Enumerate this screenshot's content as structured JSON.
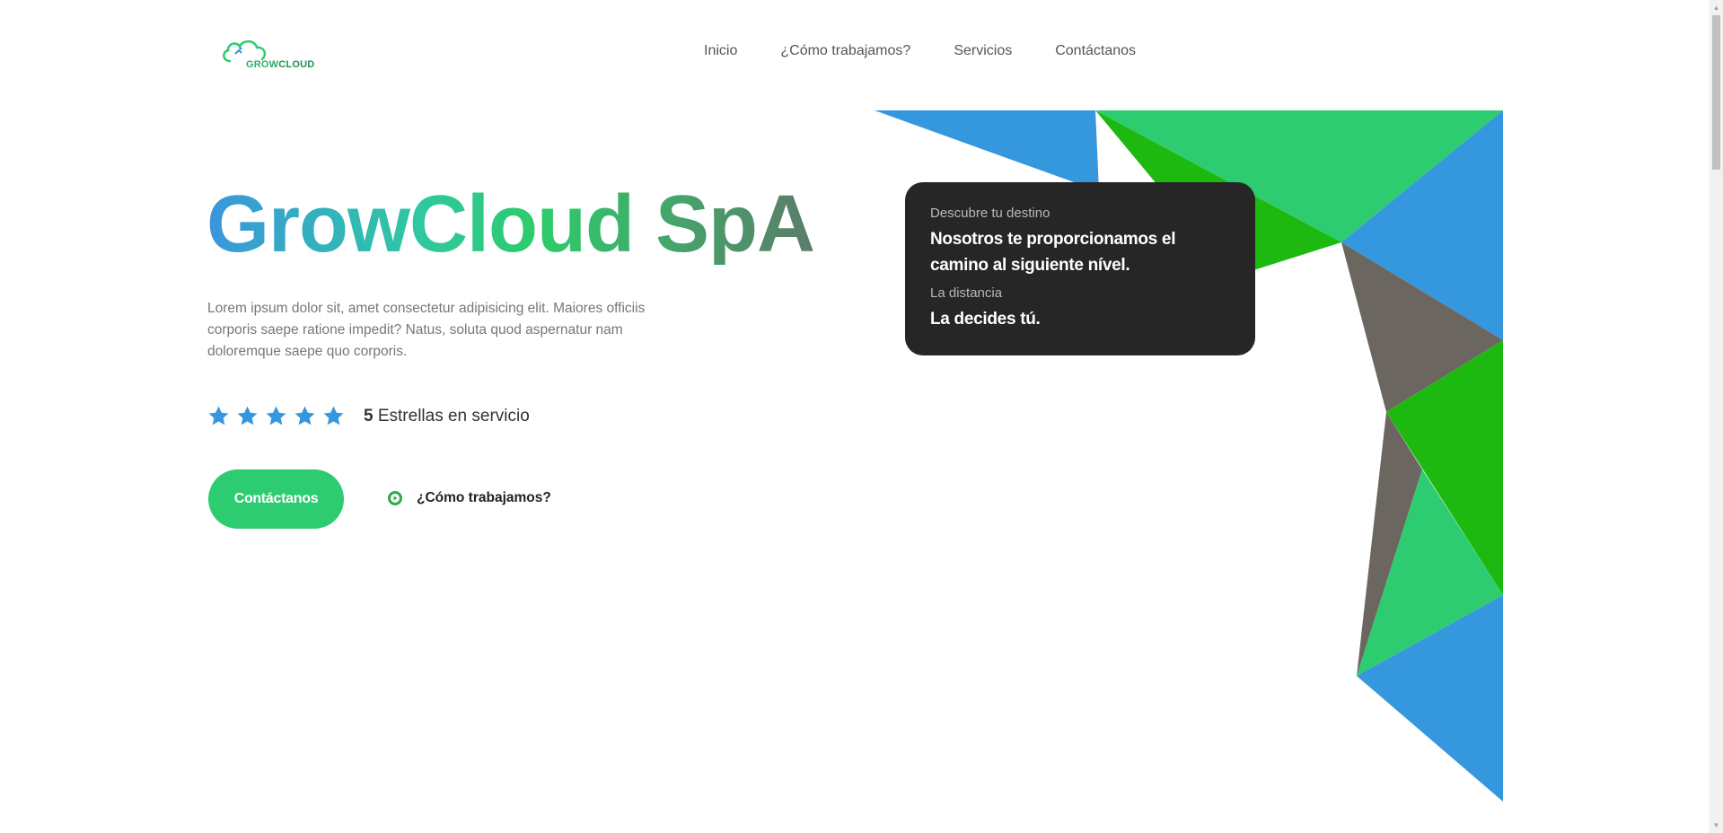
{
  "brand": {
    "logo_part1": "GROW",
    "logo_part2": "CLOUD"
  },
  "nav": {
    "items": [
      "Inicio",
      "¿Cómo trabajamos?",
      "Servicios",
      "Contáctanos"
    ]
  },
  "hero": {
    "title": "GrowCloud SpA",
    "lead": "Lorem ipsum dolor sit, amet consectetur adipisicing elit. Maiores officiis corporis saepe ratione impedit? Natus, soluta quod aspernatur nam doloremque saepe quo corporis.",
    "rating": {
      "stars": 5,
      "count_text": "5",
      "caption": "Estrellas en servicio"
    },
    "cta_label": "Contáctanos",
    "how_label": "¿Cómo trabajamos?"
  },
  "card": {
    "label1": "Descubre tu destino",
    "value1": "Nosotros te proporcionamos el camino al siguiente nível.",
    "label2": "La distancia",
    "value2": "La decides tú."
  },
  "colors": {
    "blue": "#3597dd",
    "green": "#2ecc71",
    "dark_green": "#1db911",
    "gray": "#6b6760",
    "card_bg": "#262626"
  }
}
